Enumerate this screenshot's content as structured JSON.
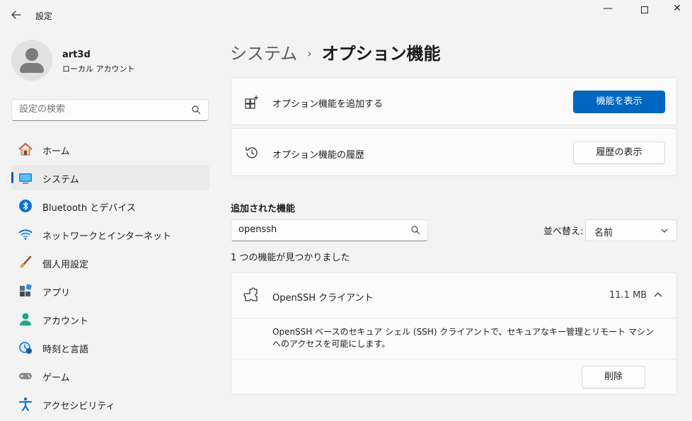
{
  "window": {
    "title": "設定",
    "back_icon": "back-arrow-icon",
    "minimize_glyph": "—",
    "close_glyph": "✕"
  },
  "user": {
    "name": "art3d",
    "account_type": "ローカル アカウント"
  },
  "search": {
    "placeholder": "設定の検索"
  },
  "sidebar": {
    "items": [
      {
        "label": "ホーム",
        "icon": "home-icon",
        "active": false
      },
      {
        "label": "システム",
        "icon": "system-icon",
        "active": true
      },
      {
        "label": "Bluetooth とデバイス",
        "icon": "bluetooth-icon",
        "active": false
      },
      {
        "label": "ネットワークとインターネット",
        "icon": "wifi-icon",
        "active": false
      },
      {
        "label": "個人用設定",
        "icon": "brush-icon",
        "active": false
      },
      {
        "label": "アプリ",
        "icon": "apps-icon",
        "active": false
      },
      {
        "label": "アカウント",
        "icon": "account-icon",
        "active": false
      },
      {
        "label": "時刻と言語",
        "icon": "time-language-icon",
        "active": false
      },
      {
        "label": "ゲーム",
        "icon": "gamepad-icon",
        "active": false
      },
      {
        "label": "アクセシビリティ",
        "icon": "accessibility-icon",
        "active": false
      }
    ]
  },
  "breadcrumb": {
    "parent": "システム",
    "separator": "›",
    "current": "オプション機能"
  },
  "add_feature": {
    "label": "オプション機能を追加する",
    "button": "機能を表示",
    "icon": "add-grid-icon"
  },
  "history": {
    "label": "オプション機能の履歴",
    "button": "履歴の表示",
    "icon": "history-icon"
  },
  "installed": {
    "title": "追加された機能",
    "filter_value": "openssh",
    "sort_label": "並べ替え:",
    "sort_value": "名前",
    "result_count": "1 つの機能が見つかりました"
  },
  "feature": {
    "name": "OpenSSH クライアント",
    "size": "11.1 MB",
    "description": "OpenSSH ベースのセキュア シェル (SSH) クライアントで、セキュアなキー管理とリモート マシンへのアクセスを可能にします。",
    "uninstall": "削除",
    "icon": "puzzle-icon"
  },
  "colors": {
    "accent": "#0067c0",
    "background": "#f3f3f3",
    "card": "#fbfbfb"
  }
}
